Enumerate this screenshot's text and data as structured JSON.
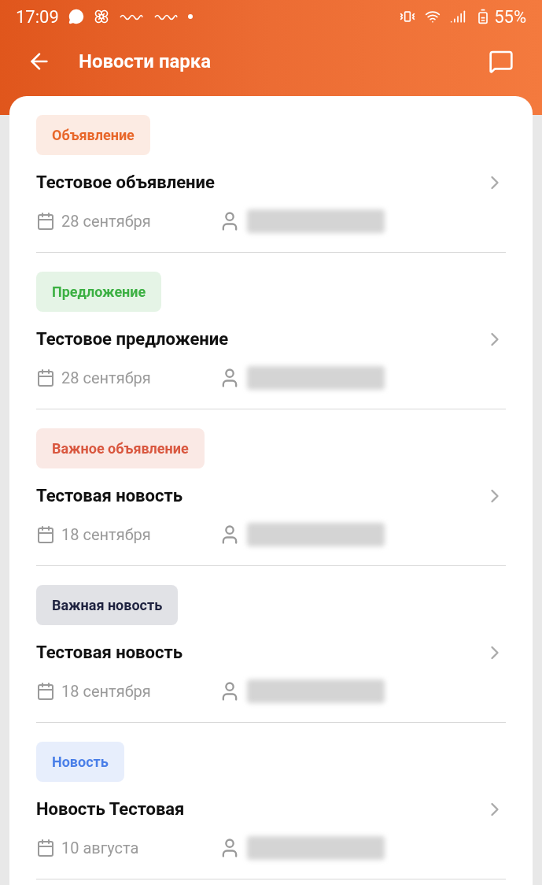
{
  "status_bar": {
    "time": "17:09",
    "battery": "55%"
  },
  "header": {
    "title": "Новости парка"
  },
  "news": [
    {
      "tag": "Объявление",
      "color": "#e8672a",
      "title": "Тестовое объявление",
      "date": "28 сентября"
    },
    {
      "tag": "Предложение",
      "color": "#3cb043",
      "title": "Тестовое предложение",
      "date": "28 сентября"
    },
    {
      "tag": "Важное объявление",
      "color": "#d9573f",
      "title": "Тестовая новость",
      "date": "18 сентября"
    },
    {
      "tag": "Важная новость",
      "color": "#1f2340",
      "title": "Тестовая новость",
      "date": "18 сентября"
    },
    {
      "tag": "Новость",
      "color": "#4a7fe8",
      "title": "Новость Тестовая",
      "date": "10 августа"
    }
  ]
}
